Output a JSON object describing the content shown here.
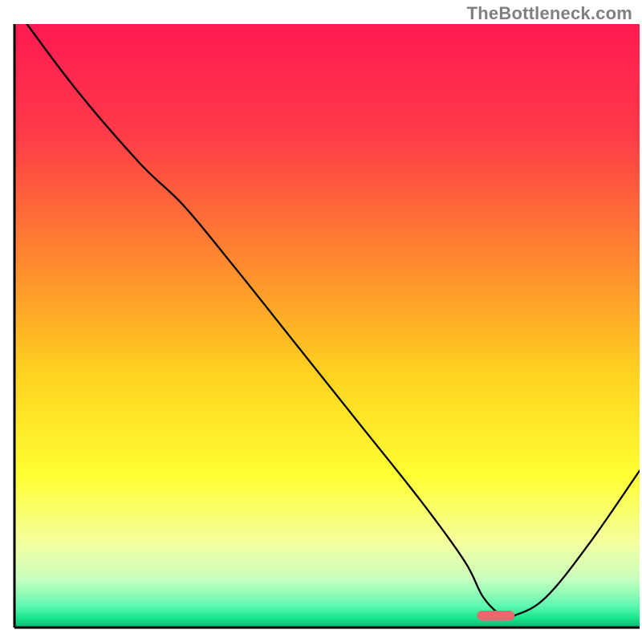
{
  "watermark": "TheBottleneck.com",
  "chart_data": {
    "type": "line",
    "title": "",
    "xlabel": "",
    "ylabel": "",
    "xlim": [
      0,
      100
    ],
    "ylim": [
      0,
      100
    ],
    "x": [
      2,
      10,
      20,
      27,
      35,
      45,
      55,
      65,
      72,
      75,
      78,
      80,
      85,
      92,
      100
    ],
    "values": [
      100,
      89,
      77,
      70,
      60,
      47,
      34,
      21,
      11,
      5,
      2,
      2,
      5,
      14,
      26
    ],
    "marker": {
      "x": 77,
      "y": 2,
      "width": 6,
      "height": 1.6,
      "color": "#e46a6f"
    },
    "gradient_stops": [
      {
        "offset": 0.0,
        "color": "#ff1a52"
      },
      {
        "offset": 0.18,
        "color": "#ff3a49"
      },
      {
        "offset": 0.4,
        "color": "#ff8b2e"
      },
      {
        "offset": 0.58,
        "color": "#ffd21f"
      },
      {
        "offset": 0.75,
        "color": "#ffff33"
      },
      {
        "offset": 0.86,
        "color": "#f4ffa0"
      },
      {
        "offset": 0.92,
        "color": "#c8ffbe"
      },
      {
        "offset": 0.965,
        "color": "#5cf7b0"
      },
      {
        "offset": 0.985,
        "color": "#16e488"
      },
      {
        "offset": 1.0,
        "color": "#0fb573"
      }
    ],
    "axis": {
      "color": "#000000",
      "width": 3
    },
    "curve": {
      "color": "#000000",
      "width": 2.3
    }
  }
}
